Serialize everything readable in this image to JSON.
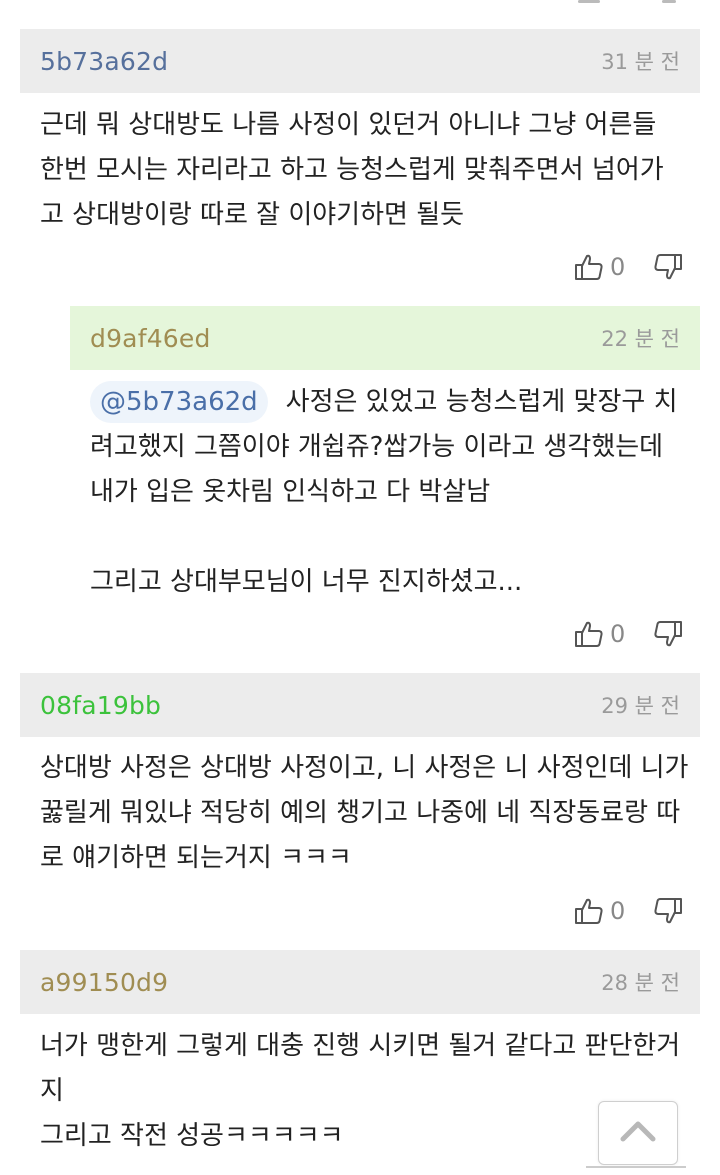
{
  "colors": {
    "header_grey": "#ececec",
    "header_green": "#e5f6da",
    "author_blue": "#56709c",
    "author_olive": "#a08d52",
    "author_green": "#3cc23c",
    "mention_blue": "#4a6fa8"
  },
  "comments": [
    {
      "author": "5b73a62d",
      "time": "31 분 전",
      "lines": [
        "근데 뭐 상대방도 나름 사정이 있던거 아니냐 그냥 어른들",
        "한번 모시는 자리라고 하고 능청스럽게 맞춰주면서 넘어가",
        "고 상대방이랑 따로 잘 이야기하면 될듯"
      ],
      "likes": "0"
    },
    {
      "author": "d9af46ed",
      "time": "22 분 전",
      "mention": "@5b73a62d",
      "lines": [
        "사정은 있었고 능청스럽게 맞장구 치",
        "려고했지 그쯤이야 개쉽쥬?쌉가능 이라고 생각했는데",
        "내가 입은 옷차림 인식하고 다 박살남",
        "",
        "그리고 상대부모님이 너무 진지하셨고..."
      ],
      "likes": "0"
    },
    {
      "author": "08fa19bb",
      "time": "29 분 전",
      "lines": [
        "상대방 사정은 상대방 사정이고, 니 사정은 니 사정인데 니가",
        "꿇릴게 뭐있냐 적당히 예의 챙기고 나중에 네 직장동료랑 따",
        "로 얘기하면 되는거지 ㅋㅋㅋ"
      ],
      "likes": "0"
    },
    {
      "author": "a99150d9",
      "time": "28 분 전",
      "lines": [
        "너가 맹한게 그렇게 대충 진행 시키면 될거 같다고 판단한거",
        "지",
        "그리고 작전 성공ㅋㅋㅋㅋㅋ"
      ]
    }
  ],
  "icons": {
    "like": "thumbs-up-icon",
    "dislike": "thumbs-down-icon",
    "scroll_top": "chevron-up-icon"
  }
}
